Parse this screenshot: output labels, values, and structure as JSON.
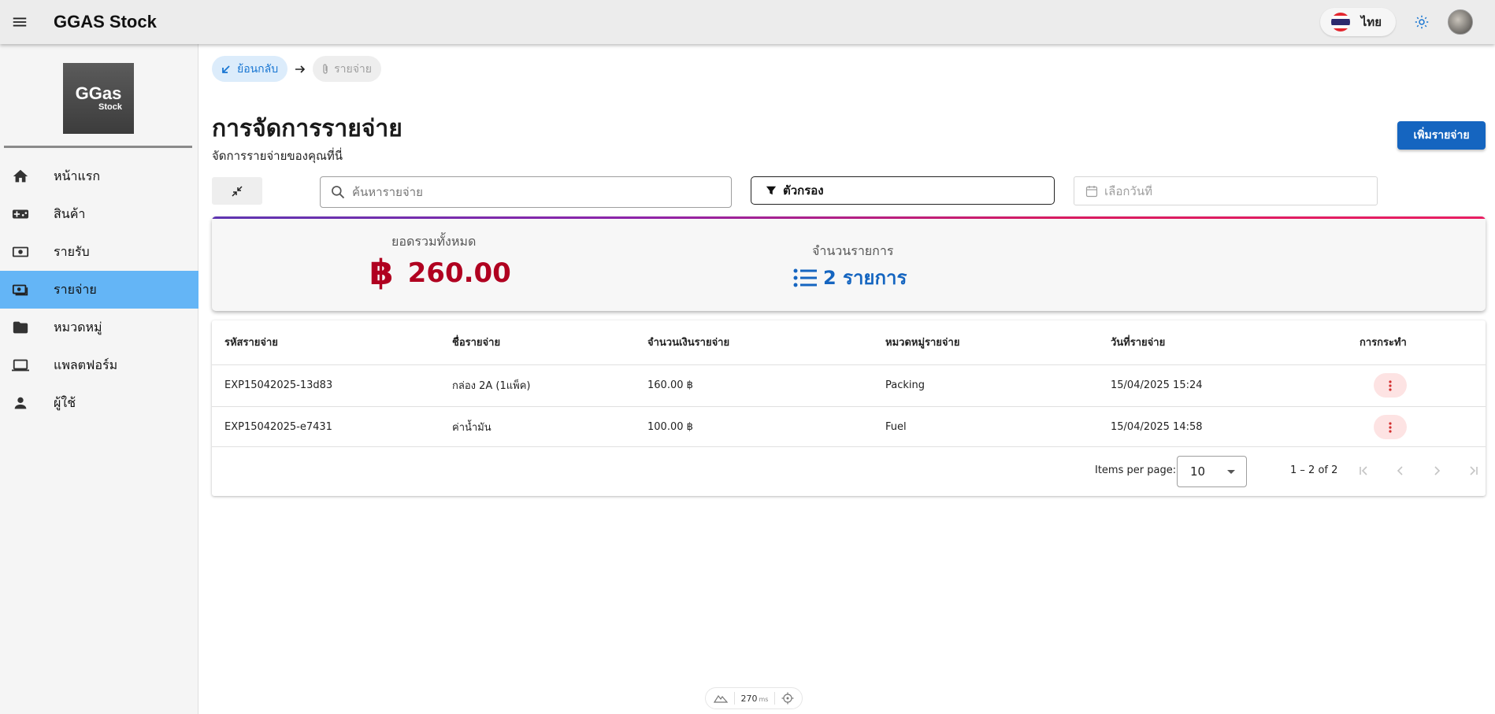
{
  "app": {
    "title": "GGAS Stock",
    "language_label": "ไทย"
  },
  "colors": {
    "accent": "#1565c0",
    "active_nav": "#64b5f6",
    "total_red": "#b00020"
  },
  "logo": {
    "main": "GGas",
    "sub": "Stock"
  },
  "sidebar": {
    "items": [
      {
        "label": "หน้าแรก",
        "icon": "home-icon"
      },
      {
        "label": "สินค้า",
        "icon": "gamepad-icon"
      },
      {
        "label": "รายรับ",
        "icon": "cash-icon"
      },
      {
        "label": "รายจ่าย",
        "icon": "payments-icon",
        "active": true
      },
      {
        "label": "หมวดหมู่",
        "icon": "folder-icon"
      },
      {
        "label": "แพลตฟอร์ม",
        "icon": "laptop-icon"
      },
      {
        "label": "ผู้ใช้",
        "icon": "person-icon"
      }
    ]
  },
  "breadcrumb": {
    "back": "ย้อนกลับ",
    "current": "รายจ่าย"
  },
  "page": {
    "title": "การจัดการรายจ่าย",
    "subtitle": "จัดการรายจ่ายของคุณที่นี่",
    "add_button": "เพิ่มรายจ่าย"
  },
  "toolbar": {
    "search_placeholder": "ค้นหารายจ่าย",
    "filter_label": "ตัวกรอง",
    "date_placeholder": "เลือกวันที่"
  },
  "summary": {
    "total_label": "ยอดรวมทั้งหมด",
    "currency_symbol": "฿",
    "total_value": "260.00",
    "count_label": "จำนวนรายการ",
    "count_value": "2 รายการ"
  },
  "table": {
    "headers": [
      "รหัสรายจ่าย",
      "ชื่อรายจ่าย",
      "จำนวนเงินรายจ่าย",
      "หมวดหมู่รายจ่าย",
      "วันที่รายจ่าย",
      "การกระทำ"
    ],
    "rows": [
      {
        "id": "EXP15042025-13d83",
        "name": "กล่อง 2A (1แพ็ค)",
        "amount": "160.00 ฿",
        "category": "Packing",
        "date": "15/04/2025 15:24"
      },
      {
        "id": "EXP15042025-e7431",
        "name": "ค่าน้ำมัน",
        "amount": "100.00 ฿",
        "category": "Fuel",
        "date": "15/04/2025 14:58"
      }
    ]
  },
  "paginator": {
    "items_per_page_label": "Items per page:",
    "items_per_page": "10",
    "range": "1 – 2 of 2"
  },
  "perf": {
    "value": "270",
    "unit": "ms"
  }
}
